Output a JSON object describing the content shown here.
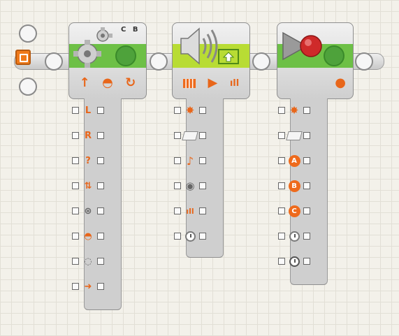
{
  "motor_block": {
    "name": "Motor",
    "port_label": "C B",
    "controls": [
      "↑",
      "◓",
      "↻"
    ],
    "hub_plugs": [
      {
        "icon": "left-motor-icon",
        "glyph": "L"
      },
      {
        "icon": "right-motor-icon",
        "glyph": "R"
      },
      {
        "icon": "other-motor-icon",
        "glyph": "?"
      },
      {
        "icon": "direction-icon",
        "glyph": "⇅"
      },
      {
        "icon": "steering-icon",
        "glyph": "⊛"
      },
      {
        "icon": "power-icon",
        "glyph": "◓"
      },
      {
        "icon": "duration-icon",
        "glyph": "◌"
      },
      {
        "icon": "next-action-icon",
        "glyph": "➜"
      }
    ]
  },
  "sound_block": {
    "name": "Sound",
    "controls": [
      "|||",
      "▶",
      "ıll"
    ],
    "hub_plugs": [
      {
        "icon": "action-icon",
        "glyph": "✸"
      },
      {
        "icon": "filename-icon",
        "glyph": ""
      },
      {
        "icon": "tone-icon",
        "glyph": "♪"
      },
      {
        "icon": "control-icon",
        "glyph": "◉"
      },
      {
        "icon": "volume-icon",
        "glyph": "ıll"
      },
      {
        "icon": "duration-icon",
        "glyph": ""
      }
    ]
  },
  "record_block": {
    "name": "Record",
    "controls": [
      "●"
    ],
    "hub_plugs": [
      {
        "icon": "action-icon",
        "glyph": "✸"
      },
      {
        "icon": "filename-icon",
        "glyph": ""
      },
      {
        "icon": "port-a-icon",
        "glyph": "A"
      },
      {
        "icon": "port-b-icon",
        "glyph": "B"
      },
      {
        "icon": "port-c-icon",
        "glyph": "C"
      },
      {
        "icon": "time-icon",
        "glyph": ""
      },
      {
        "icon": "record-time-icon",
        "glyph": ""
      }
    ]
  }
}
